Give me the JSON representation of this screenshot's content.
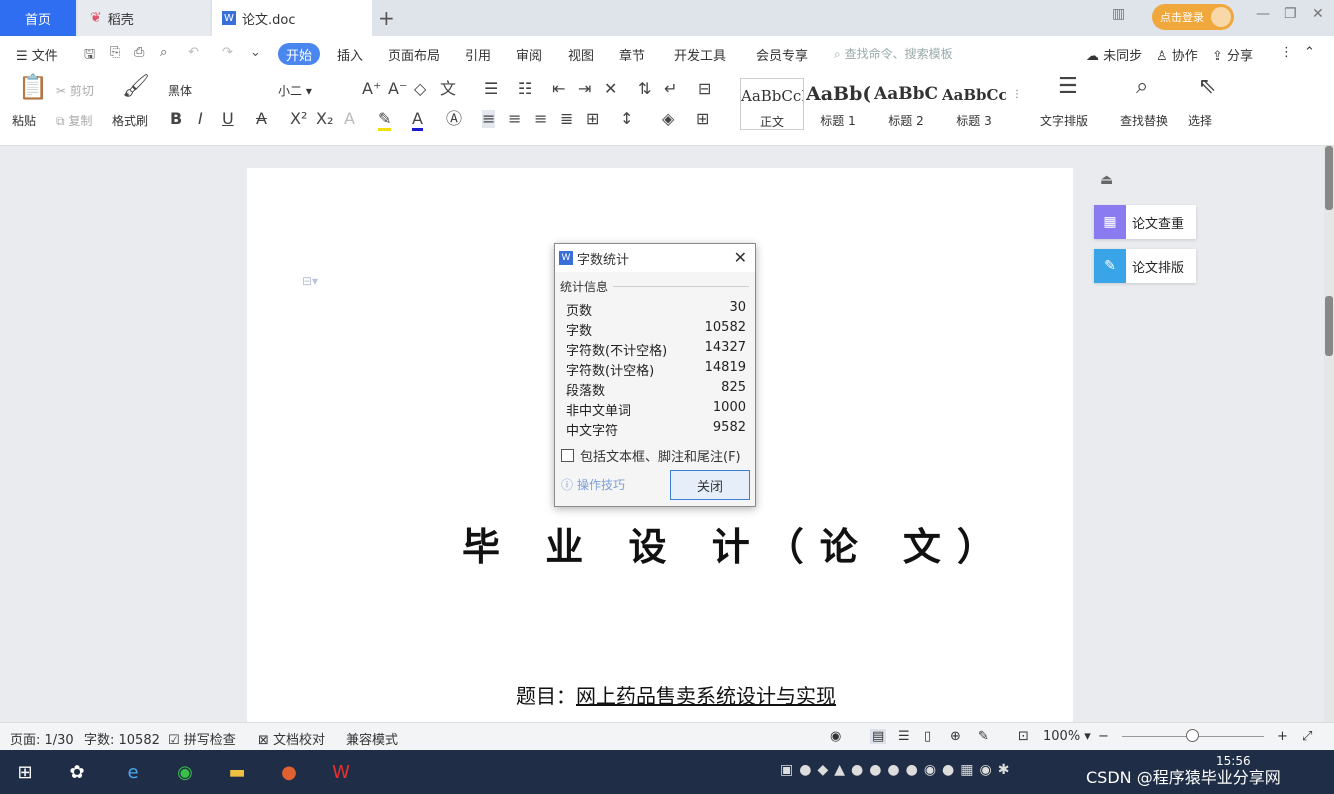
{
  "tabs": {
    "home": "首页",
    "daoke": "稻壳",
    "doc": "论文.doc"
  },
  "login_label": "点击登录",
  "menu": {
    "file": "文件",
    "start": "开始",
    "insert": "插入",
    "layout": "页面布局",
    "references": "引用",
    "review": "审阅",
    "view": "视图",
    "section": "章节",
    "devtools": "开发工具",
    "member": "会员专享",
    "search_placeholder": "查找命令、搜索模板",
    "sync": "未同步",
    "collab": "协作",
    "share": "分享"
  },
  "ribbon": {
    "paste": "粘贴",
    "cut": "剪切",
    "copy": "复制",
    "format_painter": "格式刷",
    "font_name": "黑体",
    "font_size": "小二",
    "styles": [
      {
        "preview": "AaBbCcI",
        "label": "正文"
      },
      {
        "preview": "AaBb(",
        "label": "标题 1"
      },
      {
        "preview": "AaBbC",
        "label": "标题 2"
      },
      {
        "preview": "AaBbCcI",
        "label": "标题 3"
      }
    ],
    "text_layout": "文字排版",
    "find_replace": "查找替换",
    "select": "选择"
  },
  "document": {
    "title": "毕 业 设 计（论 文）",
    "subject_label": "题目：",
    "subject_value": "网上药品售卖系统设计与实现"
  },
  "side_panel": {
    "check": "论文查重",
    "format": "论文排版"
  },
  "dialog": {
    "title": "字数统计",
    "section": "统计信息",
    "stats": [
      {
        "label": "页数",
        "value": "30"
      },
      {
        "label": "字数",
        "value": "10582"
      },
      {
        "label": "字符数(不计空格)",
        "value": "14327"
      },
      {
        "label": "字符数(计空格)",
        "value": "14819"
      },
      {
        "label": "段落数",
        "value": "825"
      },
      {
        "label": "非中文单词",
        "value": "1000"
      },
      {
        "label": "中文字符",
        "value": "9582"
      }
    ],
    "include_label": "包括文本框、脚注和尾注(F)",
    "tip": "操作技巧",
    "close": "关闭"
  },
  "status": {
    "page": "页面: 1/30",
    "words": "字数: 10582",
    "spell": "拼写检查",
    "proof": "文档校对",
    "compat": "兼容模式",
    "zoom": "100%"
  },
  "taskbar": {
    "time": "15:56",
    "watermark": "CSDN @程序猿毕业分享网"
  }
}
